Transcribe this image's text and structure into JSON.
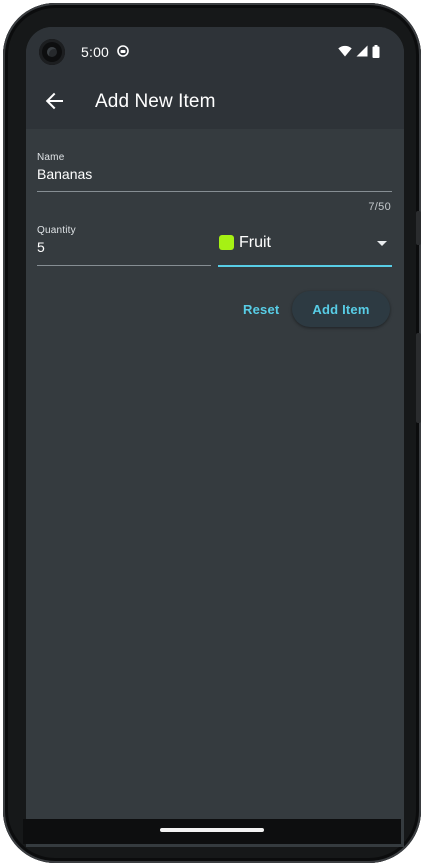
{
  "status_bar": {
    "time": "5:00",
    "icons": [
      "notification-icon",
      "wifi-icon",
      "signal-icon",
      "battery-icon"
    ]
  },
  "app_bar": {
    "title": "Add New Item",
    "back_icon": "arrow-back-icon"
  },
  "form": {
    "name": {
      "label": "Name",
      "value": "Bananas",
      "counter": "7/50"
    },
    "quantity": {
      "label": "Quantity",
      "value": "5"
    },
    "category": {
      "selected": "Fruit",
      "color": "#a6f114"
    }
  },
  "actions": {
    "reset_label": "Reset",
    "add_label": "Add Item"
  },
  "colors": {
    "app_bar": "#2e3338",
    "background": "#353b3f",
    "accent": "#58cde6"
  }
}
